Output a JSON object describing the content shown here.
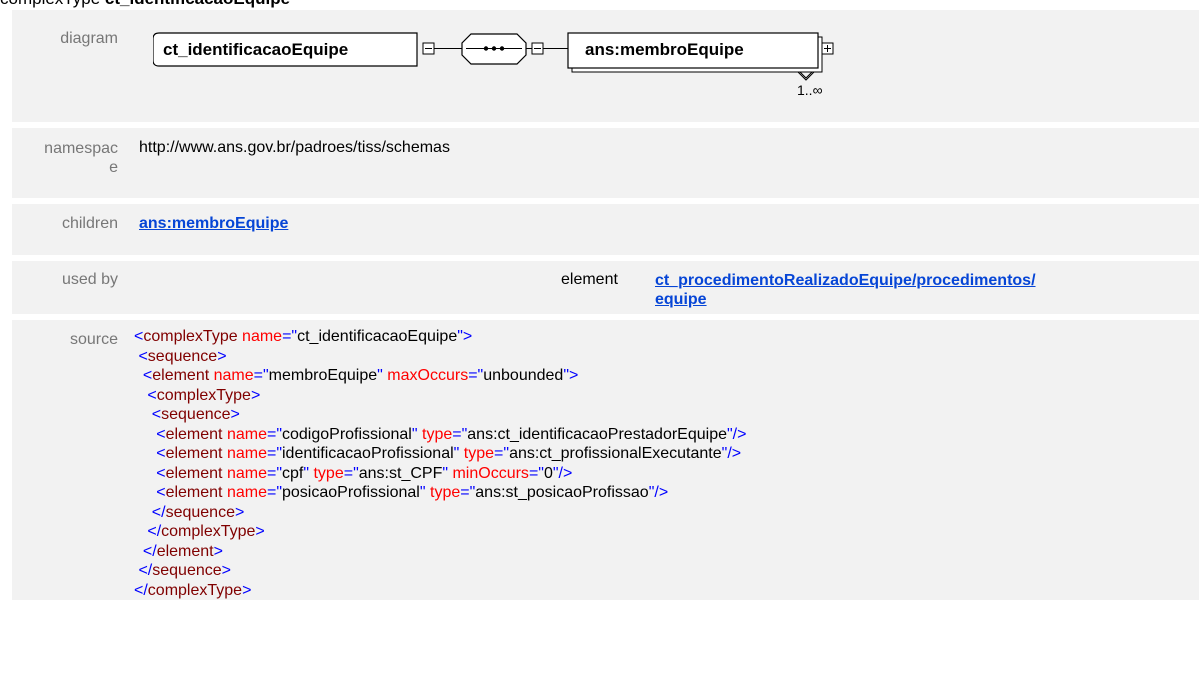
{
  "header": {
    "kind": "complexType",
    "name": "ct_identificacaoEquipe"
  },
  "labels": {
    "diagram": "diagram",
    "namespace_line1": "namespac",
    "namespace_line2": "e",
    "children": "children",
    "used_by": "used by",
    "source": "source"
  },
  "diagram": {
    "root_label": "ct_identificacaoEquipe",
    "child_label": "ans:membroEquipe",
    "cardinality": "1..∞"
  },
  "namespace": "http://www.ans.gov.br/padroes/tiss/schemas",
  "children": {
    "link": "ans:membroEquipe"
  },
  "used_by": {
    "kind": "element",
    "target_line1": "ct_procedimentoRealizadoEquipe/procedimentos/",
    "target_line2": "equipe"
  },
  "source": {
    "lines": [
      [
        [
          "b",
          "<"
        ],
        [
          "t",
          "complexType"
        ],
        [
          "a",
          " name"
        ],
        [
          "b",
          "=\""
        ],
        [
          "k",
          "ct_identificacaoEquipe"
        ],
        [
          "b",
          "\">"
        ]
      ],
      [
        [
          "k",
          " "
        ],
        [
          "b",
          "<"
        ],
        [
          "t",
          "sequence"
        ],
        [
          "b",
          ">"
        ]
      ],
      [
        [
          "k",
          "  "
        ],
        [
          "b",
          "<"
        ],
        [
          "t",
          "element"
        ],
        [
          "a",
          " name"
        ],
        [
          "b",
          "=\""
        ],
        [
          "k",
          "membroEquipe"
        ],
        [
          "b",
          "\""
        ],
        [
          "a",
          " maxOccurs"
        ],
        [
          "b",
          "=\""
        ],
        [
          "k",
          "unbounded"
        ],
        [
          "b",
          "\">"
        ]
      ],
      [
        [
          "k",
          "   "
        ],
        [
          "b",
          "<"
        ],
        [
          "t",
          "complexType"
        ],
        [
          "b",
          ">"
        ]
      ],
      [
        [
          "k",
          "    "
        ],
        [
          "b",
          "<"
        ],
        [
          "t",
          "sequence"
        ],
        [
          "b",
          ">"
        ]
      ],
      [
        [
          "k",
          "     "
        ],
        [
          "b",
          "<"
        ],
        [
          "t",
          "element"
        ],
        [
          "a",
          " name"
        ],
        [
          "b",
          "=\""
        ],
        [
          "k",
          "codigoProfissional"
        ],
        [
          "b",
          "\""
        ],
        [
          "a",
          " type"
        ],
        [
          "b",
          "=\""
        ],
        [
          "k",
          "ans:ct_identificacaoPrestadorEquipe"
        ],
        [
          "b",
          "\"/>"
        ]
      ],
      [
        [
          "k",
          "     "
        ],
        [
          "b",
          "<"
        ],
        [
          "t",
          "element"
        ],
        [
          "a",
          " name"
        ],
        [
          "b",
          "=\""
        ],
        [
          "k",
          "identificacaoProfissional"
        ],
        [
          "b",
          "\""
        ],
        [
          "a",
          " type"
        ],
        [
          "b",
          "=\""
        ],
        [
          "k",
          "ans:ct_profissionalExecutante"
        ],
        [
          "b",
          "\"/>"
        ]
      ],
      [
        [
          "k",
          "     "
        ],
        [
          "b",
          "<"
        ],
        [
          "t",
          "element"
        ],
        [
          "a",
          " name"
        ],
        [
          "b",
          "=\""
        ],
        [
          "k",
          "cpf"
        ],
        [
          "b",
          "\""
        ],
        [
          "a",
          " type"
        ],
        [
          "b",
          "=\""
        ],
        [
          "k",
          "ans:st_CPF"
        ],
        [
          "b",
          "\""
        ],
        [
          "a",
          " minOccurs"
        ],
        [
          "b",
          "=\""
        ],
        [
          "k",
          "0"
        ],
        [
          "b",
          "\"/>"
        ]
      ],
      [
        [
          "k",
          "     "
        ],
        [
          "b",
          "<"
        ],
        [
          "t",
          "element"
        ],
        [
          "a",
          " name"
        ],
        [
          "b",
          "=\""
        ],
        [
          "k",
          "posicaoProfissional"
        ],
        [
          "b",
          "\""
        ],
        [
          "a",
          " type"
        ],
        [
          "b",
          "=\""
        ],
        [
          "k",
          "ans:st_posicaoProfissao"
        ],
        [
          "b",
          "\"/>"
        ]
      ],
      [
        [
          "k",
          "    "
        ],
        [
          "b",
          "</"
        ],
        [
          "t",
          "sequence"
        ],
        [
          "b",
          ">"
        ]
      ],
      [
        [
          "k",
          "   "
        ],
        [
          "b",
          "</"
        ],
        [
          "t",
          "complexType"
        ],
        [
          "b",
          ">"
        ]
      ],
      [
        [
          "k",
          "  "
        ],
        [
          "b",
          "</"
        ],
        [
          "t",
          "element"
        ],
        [
          "b",
          ">"
        ]
      ],
      [
        [
          "k",
          " "
        ],
        [
          "b",
          "</"
        ],
        [
          "t",
          "sequence"
        ],
        [
          "b",
          ">"
        ]
      ],
      [
        [
          "b",
          "</"
        ],
        [
          "t",
          "complexType"
        ],
        [
          "b",
          ">"
        ]
      ]
    ]
  }
}
